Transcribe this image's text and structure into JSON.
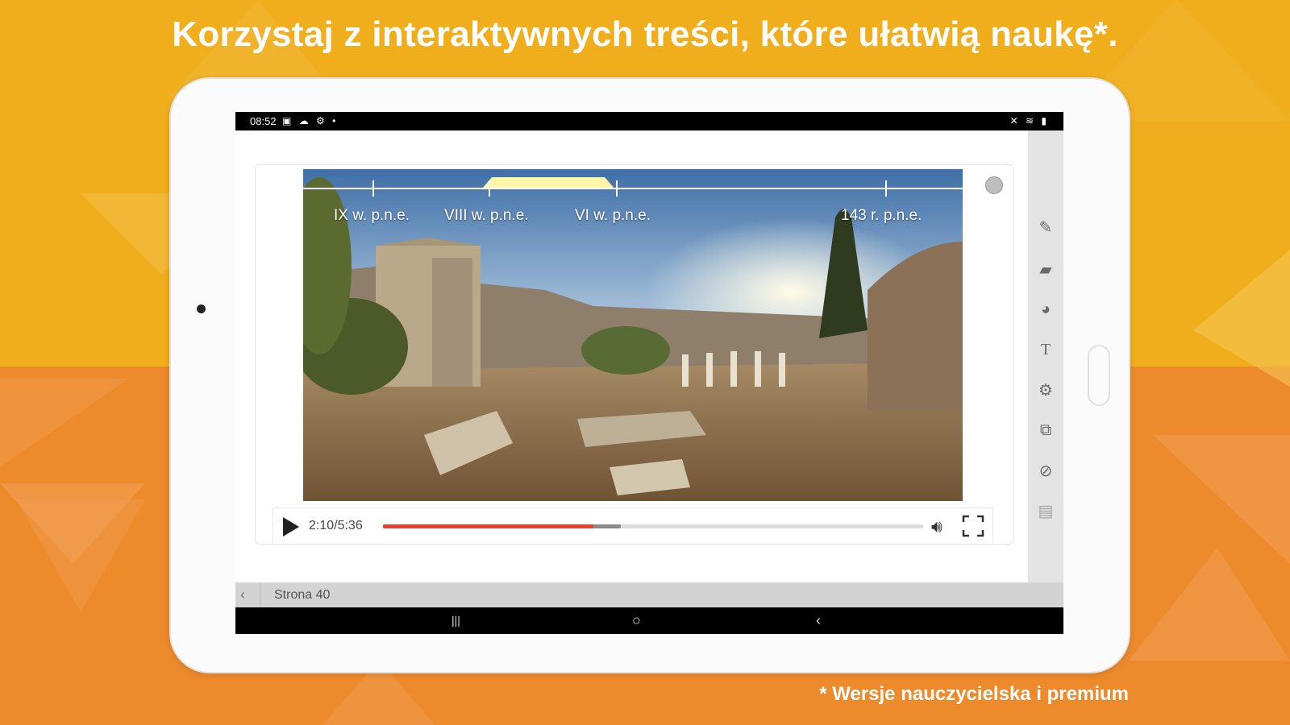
{
  "headline": "Korzystaj z interaktywnych treści, które ułatwią naukę*.",
  "footnote": "* Wersje nauczycielska i premium",
  "colors": {
    "bg_top": "#f0ae1c",
    "bg_bottom": "#ec8a2c",
    "progress": "#e8402b",
    "timeline_highlight": "#fff6a8"
  },
  "statusbar": {
    "time": "08:52",
    "left_icons": "▣ ☁ ⚙ •",
    "right_icons": "✕ ≋ ▮"
  },
  "video": {
    "timeline_labels": [
      "IX w. p.n.e.",
      "VIII w. p.n.e.",
      "VI w. p.n.e.",
      "143 r. p.n.e."
    ],
    "time_display": "2:10/5:36",
    "progress_fraction": 0.39,
    "buffered_fraction": 0.44,
    "play_icon": "play-icon",
    "volume_icon": "volume-icon",
    "fullscreen_icon": "fullscreen-icon"
  },
  "toolbar": {
    "tools": [
      {
        "name": "pencil-icon",
        "glyph": "✎"
      },
      {
        "name": "eraser-icon",
        "glyph": "▰"
      },
      {
        "name": "shapes-icon",
        "glyph": "◕"
      },
      {
        "name": "text-icon",
        "glyph": "T"
      },
      {
        "name": "settings-icon",
        "glyph": "⚙"
      },
      {
        "name": "crop-icon",
        "glyph": "⧉"
      },
      {
        "name": "hide-icon",
        "glyph": "⊘"
      },
      {
        "name": "save-icon",
        "glyph": "▤"
      }
    ]
  },
  "pagebar": {
    "back_glyph": "‹",
    "label": "Strona 40"
  },
  "navbar": {
    "recent": "|||",
    "home": "○",
    "back": "‹"
  }
}
